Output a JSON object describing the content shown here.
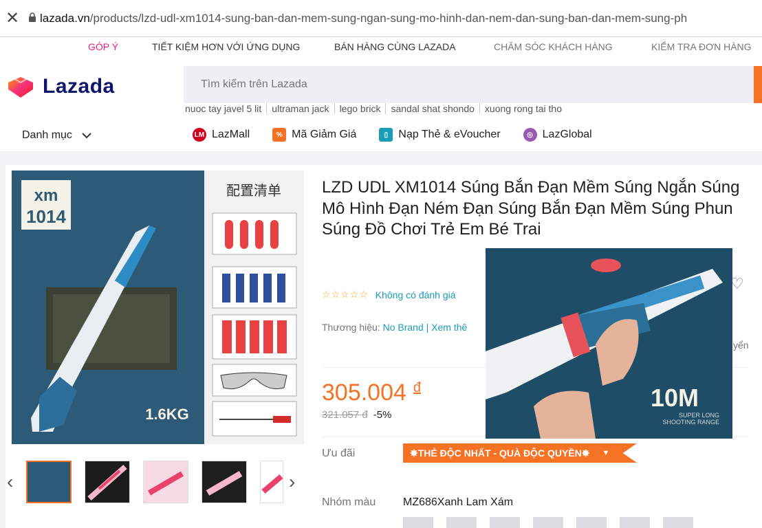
{
  "browser": {
    "host": "lazada.vn",
    "path": "/products/lzd-udl-xm1014-sung-ban-dan-mem-sung-ngan-sung-mo-hinh-dan-nem-dan-sung-ban-dan-mem-sung-ph"
  },
  "topnav": {
    "feedback": "GÓP Ý",
    "save_app": "TIẾT KIỆM HƠN VỚI ỨNG DỤNG",
    "sell": "BÁN HÀNG CÙNG LAZADA",
    "care": "CHĂM SÓC KHÁCH HÀNG",
    "track": "KIỂM TRA ĐƠN HÀNG"
  },
  "header": {
    "logo_text": "Lazada",
    "search_placeholder": "Tìm kiếm trên Lazada",
    "suggestions": [
      "nuoc tay javel 5 lit",
      "ultraman jack",
      "lego brick",
      "sandal shat shondo",
      "xuong rong tai tho"
    ],
    "category_label": "Danh mục",
    "nav": [
      "LazMall",
      "Mã Giảm Giá",
      "Nạp Thẻ & eVoucher",
      "LazGlobal"
    ]
  },
  "product": {
    "title": "LZD UDL XM1014 Súng Bắn Đạn Mềm Súng Ngắn Súng Mô Hình Đạn Ném Đạn Súng Bắn Đạn Mềm Súng Phun Súng Đồ Chơi Trẻ Em Bé Trai",
    "rating_text": "Không có đánh giá",
    "brand_label": "Thương hiệu:",
    "brand": "No Brand",
    "brand_more": "| Xem thê",
    "price": "305.004",
    "currency": "đ",
    "old_price": "321.057 đ",
    "discount": "-5%",
    "offer_label": "Ưu đãi",
    "offer": "✸THẺ ĐỘC NHẤT - QUÀ ĐỘC QUYỀN✸",
    "color_label": "Nhóm màu",
    "color_value": "MZ686Xanh Lam Xám",
    "side_text": "yển"
  },
  "gallery": {
    "model": "xm\n1014",
    "weight": "1.6KG",
    "list_title": "配置清单",
    "overlay_range": "10M",
    "overlay_sub": "SUPER LONG SHOOTING RANGE"
  },
  "colors": {
    "accent": "#f57224",
    "link": "#1a9cb7",
    "navy": "#0f146d"
  }
}
